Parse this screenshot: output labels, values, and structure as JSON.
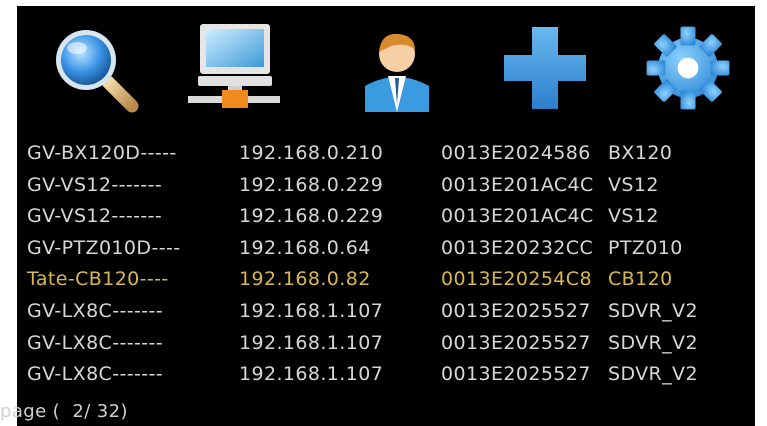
{
  "toolbar": {
    "items": [
      {
        "icon": "search-icon",
        "action": "search"
      },
      {
        "icon": "network-computer-icon",
        "action": "network"
      },
      {
        "icon": "user-icon",
        "action": "user"
      },
      {
        "icon": "add-icon",
        "action": "add"
      },
      {
        "icon": "gear-icon",
        "action": "settings"
      }
    ]
  },
  "devices": [
    {
      "name": "GV-BX120D-----",
      "ip": "192.168.0.210",
      "mac": "0013E2024586",
      "model": "BX120"
    },
    {
      "name": "GV-VS12-------",
      "ip": "192.168.0.229",
      "mac": "0013E201AC4C",
      "model": "VS12"
    },
    {
      "name": "GV-VS12-------",
      "ip": "192.168.0.229",
      "mac": "0013E201AC4C",
      "model": "VS12"
    },
    {
      "name": "GV-PTZ010D----",
      "ip": "192.168.0.64",
      "mac": "0013E20232CC",
      "model": "PTZ010"
    },
    {
      "name": "Tate-CB120----",
      "ip": "192.168.0.82",
      "mac": "0013E20254C8",
      "model": "CB120"
    },
    {
      "name": "GV-LX8C-------",
      "ip": "192.168.1.107",
      "mac": "0013E2025527",
      "model": "SDVR_V2"
    },
    {
      "name": "GV-LX8C-------",
      "ip": "192.168.1.107",
      "mac": "0013E2025527",
      "model": "SDVR_V2"
    },
    {
      "name": "GV-LX8C-------",
      "ip": "192.168.1.107",
      "mac": "0013E2025527",
      "model": "SDVR_V2"
    }
  ],
  "selected_index": 4,
  "colors": {
    "background": "#000000",
    "text": "#d7d7d7",
    "selected_text": "#d9b84f",
    "icon_blue": "#3a9be0",
    "icon_orange": "#f08a1c"
  },
  "pagination": {
    "label": "page (  2/ 32)"
  }
}
